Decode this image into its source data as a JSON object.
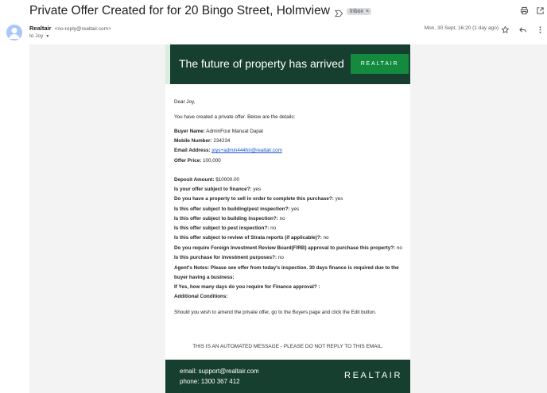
{
  "email": {
    "subject": "Private Offer Created for for 20 Bingo Street, Holmview",
    "label": "Inbox",
    "label_close": "×",
    "sender_name": "Realtair",
    "sender_email": "<no-reply@realtair.com>",
    "to_line": "to Joy",
    "date": "Mon, 30 Sept, 16:20 (1 day ago)"
  },
  "icons": {
    "top_actions": [
      "print-icon",
      "open-in-new-window-icon"
    ],
    "row_actions": [
      "star-icon",
      "reply-icon",
      "more-vert-icon"
    ]
  },
  "content": {
    "banner_title": "The future of property has arrived",
    "banner_logo": "REALTAIR",
    "greeting": "Dear Joy,",
    "intro": "You have created a private offer. Below are the details:",
    "buyer_name_label": "Buyer Name:",
    "buyer_name": "AdminFour Manual Dapat",
    "mobile_label": "Mobile Number:",
    "mobile": "234234",
    "email_label": "Email Address:",
    "email_value": "joys+admin444hir@realtair.com",
    "price_label": "Offer Price:",
    "price": "100,000",
    "deposit_label": "Deposit Amount:",
    "deposit": "$10000.00",
    "q_finance_label": "Is your offer subject to finance?:",
    "q_finance": "yes",
    "q_sell_label": "Do you have a property to sell in order to complete this purchase?:",
    "q_sell": "yes",
    "q_buildpest_label": "Is this offer subject to building/pest inspection?:",
    "q_buildpest": "yes",
    "q_building_label": "Is this offer subject to building inspection?:",
    "q_building": "no",
    "q_pest_label": "Is this offer subject to pest inspection?:",
    "q_pest": "no",
    "q_strata_label": "Is this offer subject to review of Strata reports (if applicable)?:",
    "q_strata": "no",
    "q_firb_label": "Do you require Foreign Investment Review Board(FIRB) approval to purchase this property?:",
    "q_firb": "no",
    "q_invest_label": "Is this purchase for investment purposes?:",
    "q_invest": "no",
    "notes_line1": "Agent's Notes: Please see offer from today's inspection. 30 days finance is required due to the",
    "notes_line2": "buyer having a business:",
    "finance_days": "If Yes, how many days do you require for Finance approval? :",
    "additional": "Additional Conditions:",
    "amend": "Should you wish to amend the private offer, go to the Buyers page and click the Edit button.",
    "auto_message": "THIS IS AN AUTOMATED MESSAGE - PLEASE DO NOT REPLY TO THIS EMAIL.",
    "footer_email": "email: support@realtair.com",
    "footer_phone": "phone: 1300 367 412",
    "footer_logo": "REALTAIR"
  }
}
